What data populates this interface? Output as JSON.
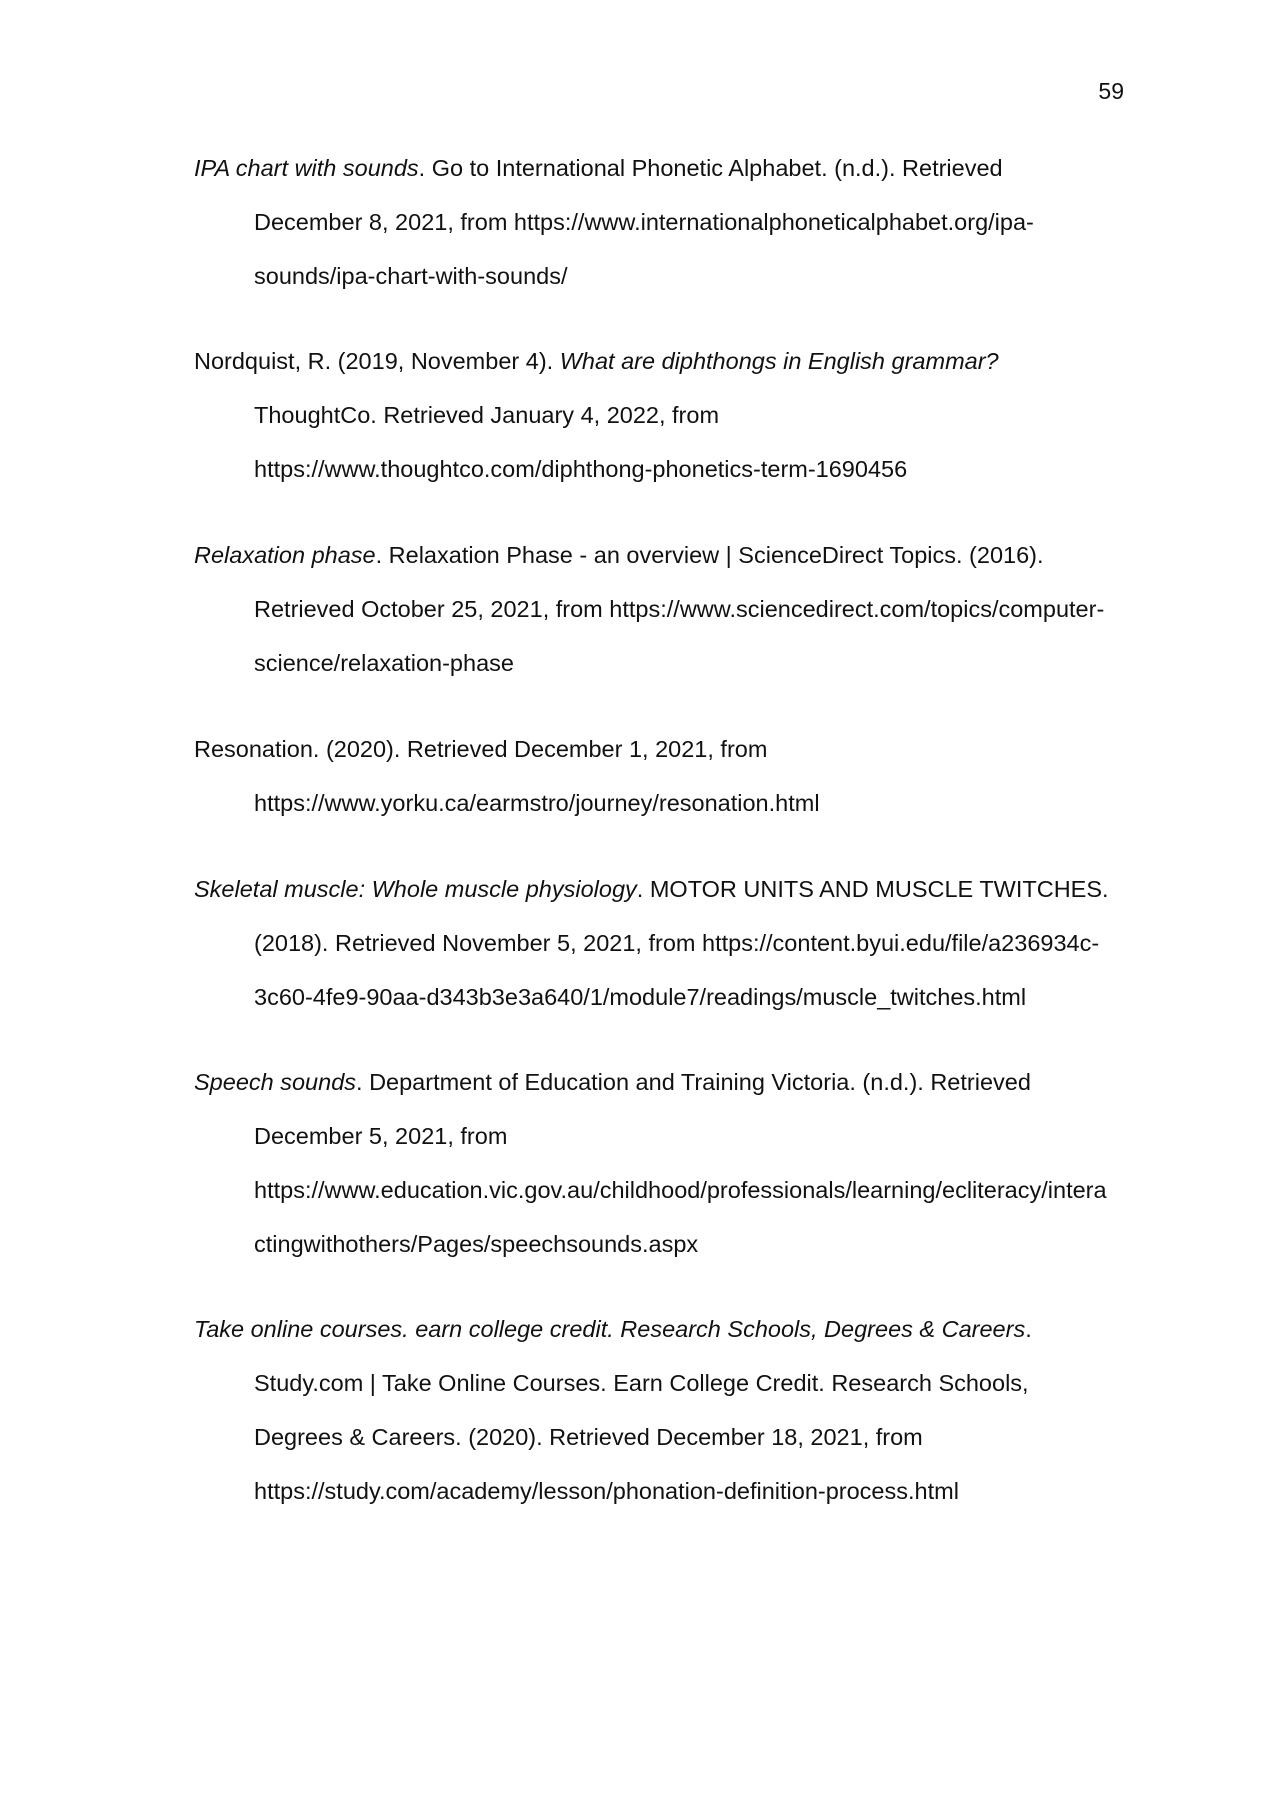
{
  "page_number": "59",
  "references": [
    {
      "lines": [
        {
          "italic": "IPA chart with sounds",
          "plain": ". Go to International Phonetic Alphabet. (n.d.). Retrieved"
        },
        {
          "plain": "December 8, 2021, from https://www.internationalphoneticalphabet.org/ipa-"
        },
        {
          "plain": "sounds/ipa-chart-with-sounds/"
        }
      ]
    },
    {
      "lines": [
        {
          "plain": "Nordquist, R. (2019, November 4). ",
          "italic": "What are diphthongs in English grammar?"
        },
        {
          "plain": "ThoughtCo. Retrieved January 4, 2022, from"
        },
        {
          "plain": "https://www.thoughtco.com/diphthong-phonetics-term-1690456"
        }
      ]
    },
    {
      "lines": [
        {
          "italic": "Relaxation phase",
          "plain": ". Relaxation Phase - an overview | ScienceDirect Topics. (2016)."
        },
        {
          "plain": "Retrieved October 25, 2021, from https://www.sciencedirect.com/topics/computer-"
        },
        {
          "plain": "science/relaxation-phase"
        }
      ]
    },
    {
      "lines": [
        {
          "plain": "Resonation. (2020). Retrieved December 1, 2021, from"
        },
        {
          "plain": "https://www.yorku.ca/earmstro/journey/resonation.html"
        }
      ]
    },
    {
      "lines": [
        {
          "italic": "Skeletal muscle: Whole muscle physiology",
          "plain": ". MOTOR UNITS AND MUSCLE TWITCHES."
        },
        {
          "plain": "(2018). Retrieved November 5, 2021, from https://content.byui.edu/file/a236934c-"
        },
        {
          "plain": "3c60-4fe9-90aa-d343b3e3a640/1/module7/readings/muscle_twitches.html"
        }
      ]
    },
    {
      "lines": [
        {
          "italic": "Speech sounds",
          "plain": ". Department of Education and Training Victoria. (n.d.). Retrieved"
        },
        {
          "plain": "December 5, 2021, from"
        },
        {
          "plain": "https://www.education.vic.gov.au/childhood/professionals/learning/ecliteracy/intera"
        },
        {
          "plain": "ctingwithothers/Pages/speechsounds.aspx"
        }
      ]
    },
    {
      "lines": [
        {
          "italic": "Take online courses. earn college credit. Research Schools, Degrees & Careers",
          "plain": "."
        },
        {
          "plain": "Study.com | Take Online Courses. Earn College Credit. Research Schools,"
        },
        {
          "plain": "Degrees & Careers. (2020). Retrieved December 18, 2021, from"
        },
        {
          "plain": "https://study.com/academy/lesson/phonation-definition-process.html"
        }
      ]
    }
  ]
}
